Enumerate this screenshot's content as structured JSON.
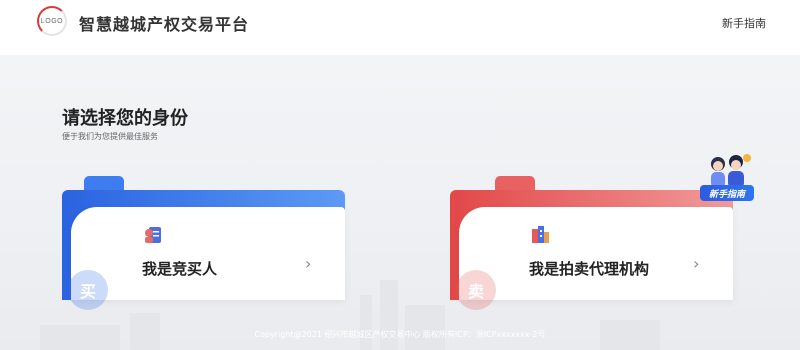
{
  "header": {
    "logo_text": "LOGO",
    "title": "智慧越城产权交易平台",
    "guide_link": "新手指南"
  },
  "main": {
    "heading": "请选择您的身份",
    "subheading": "便于我们为您提供最佳服务",
    "cards": [
      {
        "label": "我是竞买人",
        "watermark": "买",
        "accent": "#2f6fe8",
        "icon": "buyer-icon"
      },
      {
        "label": "我是拍卖代理机构",
        "watermark": "卖",
        "accent": "#e95a5a",
        "icon": "building-icon"
      }
    ],
    "badge": "新手指南"
  },
  "footer": {
    "copyright": "Copyright@2021 绍兴市越城区产权交易中心 版权所有ICP：浙ICPxxxxxxx-2号"
  },
  "colors": {
    "accent_blue": "#2f6fe8",
    "accent_red": "#e95a5a",
    "background": "#f3f4f6"
  }
}
